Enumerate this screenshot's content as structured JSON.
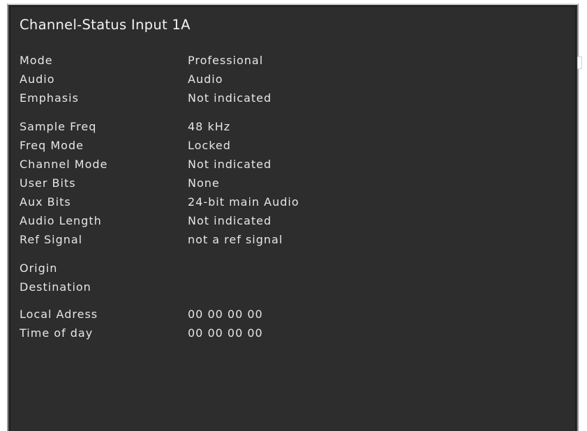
{
  "title": "Channel-Status Input 1A",
  "groups": {
    "basic": [
      {
        "label": "Mode",
        "value": "Professional"
      },
      {
        "label": "Audio",
        "value": "Audio"
      },
      {
        "label": "Emphasis",
        "value": "Not indicated"
      }
    ],
    "format": [
      {
        "label": "Sample Freq",
        "value": "48 kHz"
      },
      {
        "label": "Freq Mode",
        "value": "Locked"
      },
      {
        "label": "Channel Mode",
        "value": "Not indicated"
      },
      {
        "label": "User Bits",
        "value": "None"
      },
      {
        "label": "Aux Bits",
        "value": "24-bit main Audio"
      },
      {
        "label": "Audio Length",
        "value": "Not indicated"
      },
      {
        "label": "Ref Signal",
        "value": "not a ref signal"
      }
    ],
    "routing": [
      {
        "label": "Origin",
        "value": ""
      },
      {
        "label": "Destination",
        "value": ""
      }
    ],
    "timing": [
      {
        "label": "Local Adress",
        "value": "00 00 00 00"
      },
      {
        "label": "Time of day",
        "value": "00 00 00 00"
      }
    ]
  },
  "colors": {
    "panel_background": "#2d2d2d",
    "text": "#e6e6e6"
  }
}
